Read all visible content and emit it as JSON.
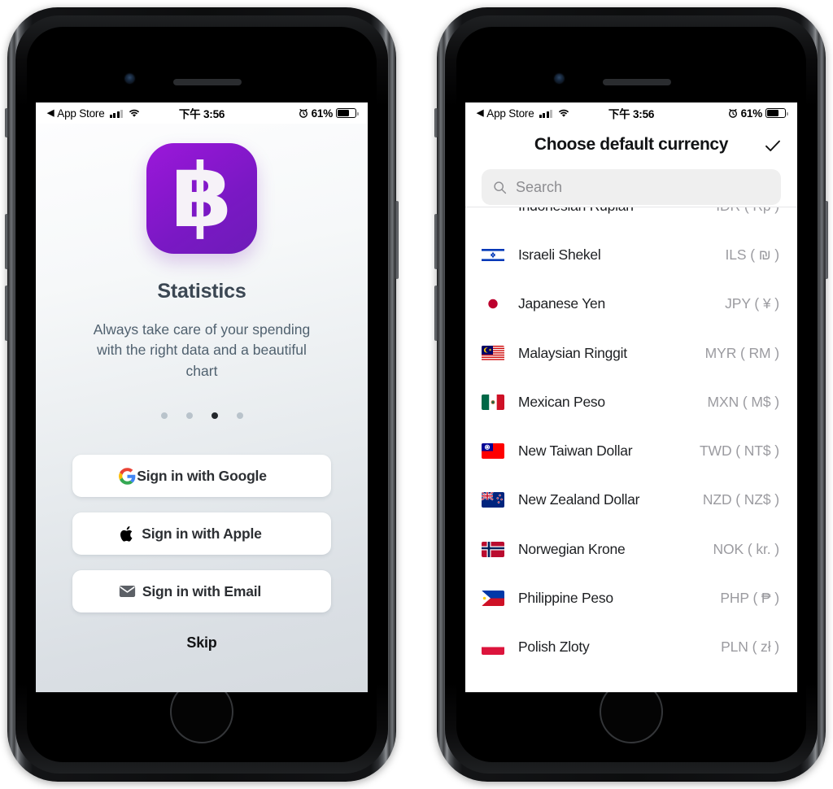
{
  "status_bar": {
    "back_label": "App Store",
    "back_arrow": "◀",
    "time": "下午 3:56",
    "battery_percent": "61%",
    "signal_icon": "cellular-signal-icon",
    "wifi_icon": "wifi-icon",
    "alarm_icon": "alarm-clock-icon",
    "battery_icon": "battery-icon"
  },
  "onboarding": {
    "app_icon_glyph": "฿",
    "app_icon_name": "baht-app-icon",
    "title": "Statistics",
    "subtitle": "Always take care of your spending with the right data and a beautiful chart",
    "page_dots": {
      "count": 4,
      "active_index": 2
    },
    "buttons": [
      {
        "label": "Sign in with Google",
        "icon": "google-icon"
      },
      {
        "label": "Sign in with Apple",
        "icon": "apple-icon"
      },
      {
        "label": "Sign in with Email",
        "icon": "envelope-icon"
      }
    ],
    "skip_label": "Skip",
    "colors": {
      "icon_purple_start": "#9b18da",
      "icon_purple_end": "#6d1cb8",
      "title_color": "#3b4753",
      "subtitle_color": "#50616f",
      "background_top": "#fdfdfe",
      "background_bottom": "#d6dbe0"
    }
  },
  "currency_picker": {
    "title": "Choose default currency",
    "confirm_icon": "checkmark-icon",
    "search": {
      "placeholder": "Search",
      "value": "",
      "icon": "search-icon"
    },
    "rows": [
      {
        "name": "Indonesian Rupiah",
        "code": "IDR ( Rp )",
        "flag": "flag-id",
        "clipped": true
      },
      {
        "name": "Israeli Shekel",
        "code": "ILS ( ₪ )",
        "flag": "flag-il"
      },
      {
        "name": "Japanese Yen",
        "code": "JPY ( ¥ )",
        "flag": "flag-jp"
      },
      {
        "name": "Malaysian Ringgit",
        "code": "MYR ( RM )",
        "flag": "flag-my"
      },
      {
        "name": "Mexican Peso",
        "code": "MXN ( M$ )",
        "flag": "flag-mx"
      },
      {
        "name": "New Taiwan Dollar",
        "code": "TWD ( NT$ )",
        "flag": "flag-tw"
      },
      {
        "name": "New Zealand Dollar",
        "code": "NZD ( NZ$ )",
        "flag": "flag-nz"
      },
      {
        "name": "Norwegian Krone",
        "code": "NOK ( kr. )",
        "flag": "flag-no"
      },
      {
        "name": "Philippine Peso",
        "code": "PHP ( ₱ )",
        "flag": "flag-ph"
      },
      {
        "name": "Polish Zloty",
        "code": "PLN ( zł )",
        "flag": "flag-pl",
        "clipped": true
      }
    ],
    "colors": {
      "code_color": "#9b9ba0",
      "name_color": "#1d1f22",
      "search_bg": "#efefef"
    }
  }
}
